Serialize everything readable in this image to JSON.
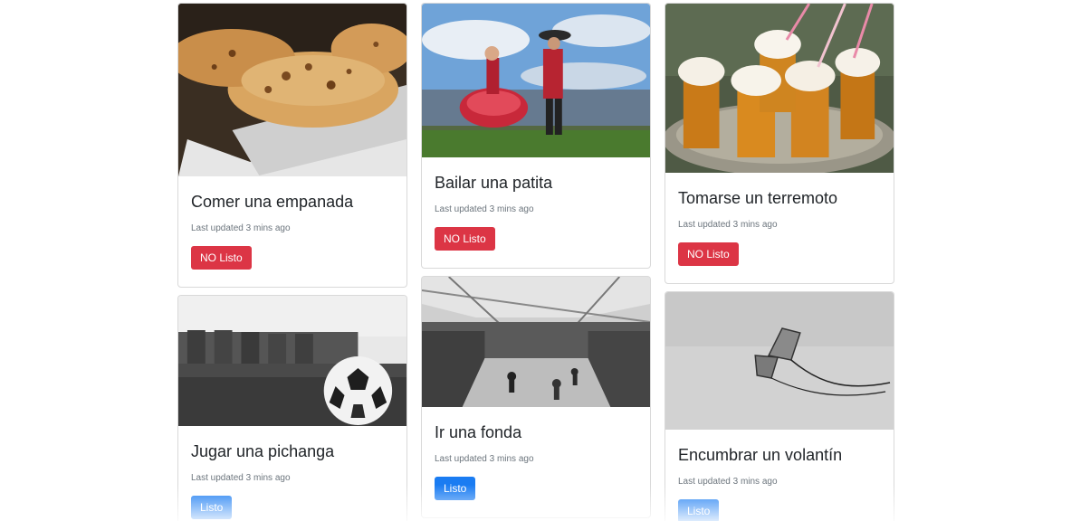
{
  "cards": [
    {
      "title": "Comer una empanada",
      "meta": "Last updated 3 mins ago",
      "button": "NO Listo",
      "status": "danger",
      "image": "empanada-photo"
    },
    {
      "title": "Bailar una patita",
      "meta": "Last updated 3 mins ago",
      "button": "NO Listo",
      "status": "danger",
      "image": "cueca-dancers-photo"
    },
    {
      "title": "Tomarse un terremoto",
      "meta": "Last updated 3 mins ago",
      "button": "NO Listo",
      "status": "danger",
      "image": "terremoto-drinks-photo"
    },
    {
      "title": "Jugar una pichanga",
      "meta": "Last updated 3 mins ago",
      "button": "Listo",
      "status": "primary",
      "image": "soccer-ball-photo"
    },
    {
      "title": "Ir una fonda",
      "meta": "Last updated 3 mins ago",
      "button": "Listo",
      "status": "primary",
      "image": "fonda-crowd-photo"
    },
    {
      "title": "Encumbrar un volantín",
      "meta": "Last updated 3 mins ago",
      "button": "Listo",
      "status": "primary",
      "image": "kite-photo"
    }
  ],
  "colors": {
    "danger": "#dc3545",
    "primary": "#1a7cf2"
  }
}
